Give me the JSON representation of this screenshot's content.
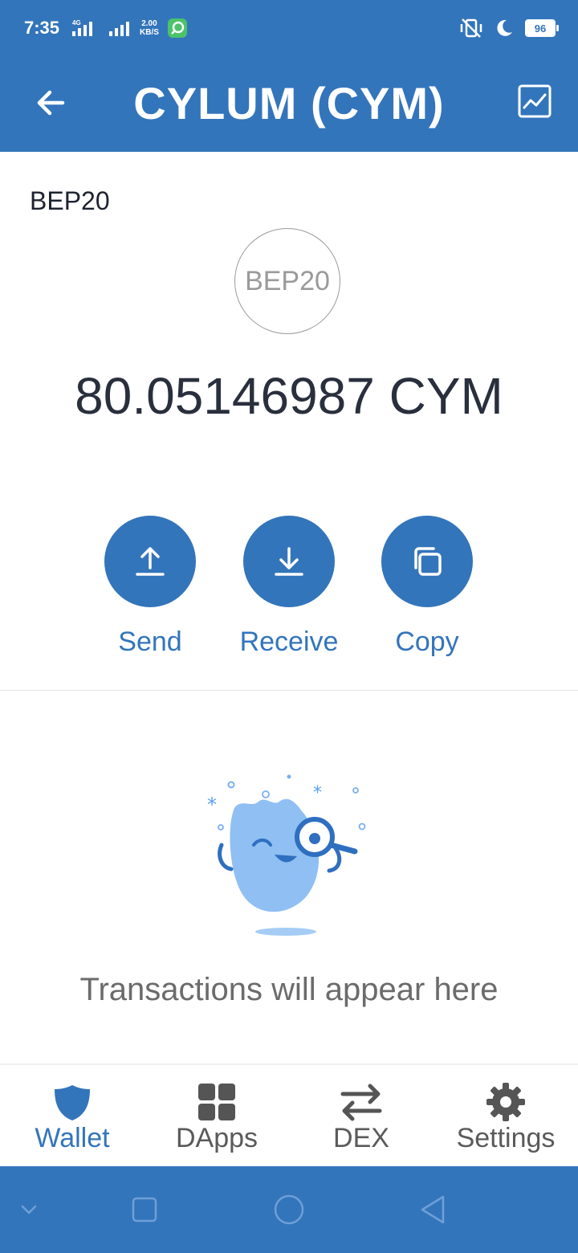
{
  "status": {
    "time": "7:35",
    "network": "4G",
    "speed_value": "2.00",
    "speed_unit": "KB/S",
    "battery": "96"
  },
  "header": {
    "title": "CYLUM (CYM)",
    "back_icon": "arrow-left-icon",
    "chart_icon": "chart-icon"
  },
  "token": {
    "standard": "BEP20",
    "logo_text": "BEP20",
    "balance": "80.05146987 CYM"
  },
  "actions": [
    {
      "label": "Send",
      "icon": "upload-icon"
    },
    {
      "label": "Receive",
      "icon": "download-icon"
    },
    {
      "label": "Copy",
      "icon": "copy-icon"
    }
  ],
  "empty_state": {
    "message": "Transactions will appear here"
  },
  "tabs": [
    {
      "label": "Wallet",
      "icon": "shield-icon",
      "active": true
    },
    {
      "label": "DApps",
      "icon": "grid-icon",
      "active": false
    },
    {
      "label": "DEX",
      "icon": "swap-icon",
      "active": false
    },
    {
      "label": "Settings",
      "icon": "gear-icon",
      "active": false
    }
  ],
  "colors": {
    "primary": "#3375bb",
    "text_dark": "#2a2f3d",
    "text_muted": "#6b6b6b",
    "illustration": "#8fbff3"
  }
}
